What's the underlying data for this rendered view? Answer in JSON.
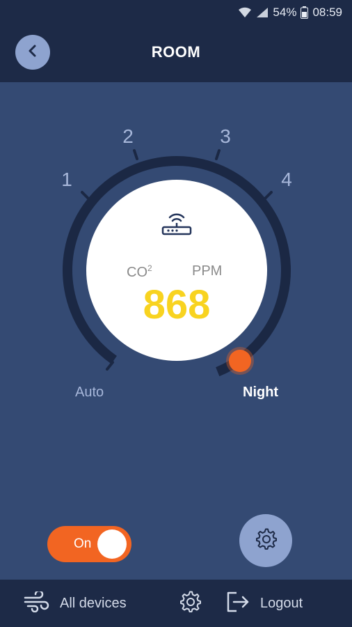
{
  "status_bar": {
    "battery": "54%",
    "time": "08:59",
    "icons": [
      "wifi-icon",
      "signal-icon",
      "battery-icon"
    ]
  },
  "header": {
    "title": "ROOM",
    "back_icon": "chevron-left-icon"
  },
  "dial": {
    "levels": [
      "1",
      "2",
      "3",
      "4"
    ],
    "modes": {
      "auto": "Auto",
      "night": "Night"
    },
    "selected_mode": "Night",
    "device_icon": "router-icon",
    "sensor_label": "CO",
    "sensor_sup": "2",
    "unit_label": "PPM",
    "reading": "868"
  },
  "controls": {
    "power_label": "On",
    "power_on": true,
    "settings_icon": "gear-icon"
  },
  "bottom_nav": {
    "all_devices": "All devices",
    "all_devices_icon": "wind-icon",
    "settings_icon": "gear-icon",
    "logout": "Logout",
    "logout_icon": "logout-icon"
  },
  "colors": {
    "background": "#344a73",
    "bars": "#1d2a47",
    "accent": "#f26522",
    "reading": "#f8d320",
    "muted": "#8ea3cf"
  }
}
